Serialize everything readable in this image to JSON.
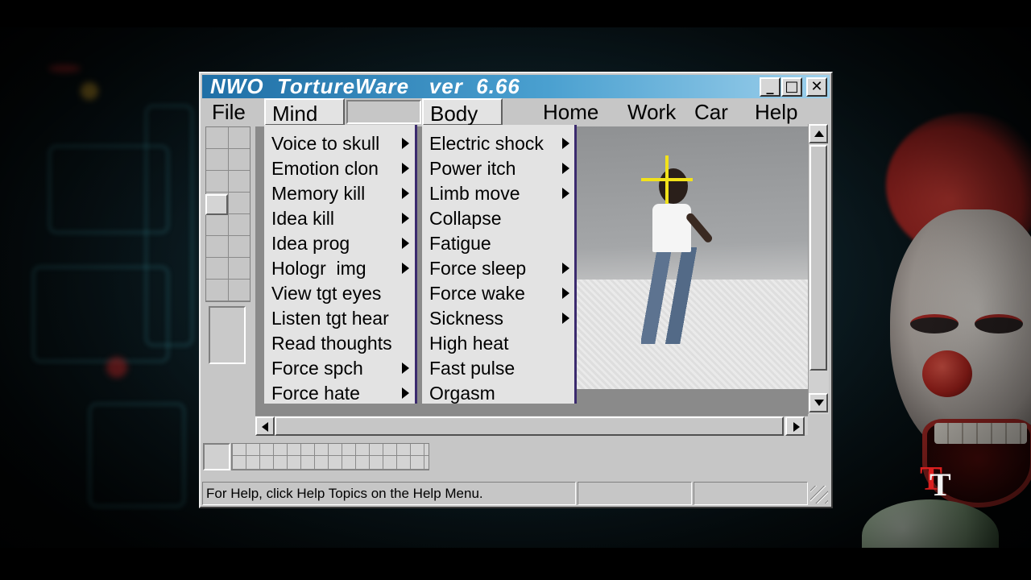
{
  "window": {
    "title": "NWO  TortureWare   ver  6.66",
    "controls": {
      "minimize": "_",
      "maximize": "□",
      "close": "✕"
    }
  },
  "menubar": {
    "file": "File",
    "mind": "Mind",
    "body": "Body",
    "home": "Home",
    "work": "Work",
    "car": "Car",
    "help": "Help"
  },
  "mind_menu": {
    "items": [
      {
        "label": "Voice to skull",
        "submenu": true
      },
      {
        "label": "Emotion clon",
        "submenu": true
      },
      {
        "label": "Memory kill",
        "submenu": true
      },
      {
        "label": "Idea kill",
        "submenu": true
      },
      {
        "label": "Idea prog",
        "submenu": true
      },
      {
        "label": "Hologr  img",
        "submenu": true
      },
      {
        "label": "View tgt eyes",
        "submenu": false
      },
      {
        "label": "Listen tgt hear",
        "submenu": false
      },
      {
        "label": "Read thoughts",
        "submenu": false
      },
      {
        "label": "Force spch",
        "submenu": true
      },
      {
        "label": "Force hate",
        "submenu": true
      }
    ]
  },
  "body_menu": {
    "items": [
      {
        "label": "Electric shock",
        "submenu": true
      },
      {
        "label": "Power itch",
        "submenu": true
      },
      {
        "label": "Limb move",
        "submenu": true
      },
      {
        "label": "Collapse",
        "submenu": false
      },
      {
        "label": "Fatigue",
        "submenu": false
      },
      {
        "label": "Force sleep",
        "submenu": true
      },
      {
        "label": "Force wake",
        "submenu": true
      },
      {
        "label": "Sickness",
        "submenu": true
      },
      {
        "label": "High heat",
        "submenu": false
      },
      {
        "label": "Fast pulse",
        "submenu": false
      },
      {
        "label": "Orgasm",
        "submenu": false
      }
    ]
  },
  "statusbar": {
    "help_text": "For Help, click Help Topics on the Help Menu."
  },
  "icons": {
    "crosshair": "crosshair-icon",
    "submenu_arrow": "submenu-arrow-icon",
    "resize_grip": "resize-grip-icon"
  },
  "colors": {
    "titlebar_start": "#1f6fa6",
    "titlebar_end": "#9fd1ec",
    "menu_border": "#3b2a6e",
    "crosshair": "#f2e21a",
    "logo_red": "#d81f1f"
  },
  "logo": {
    "text": "TT"
  }
}
